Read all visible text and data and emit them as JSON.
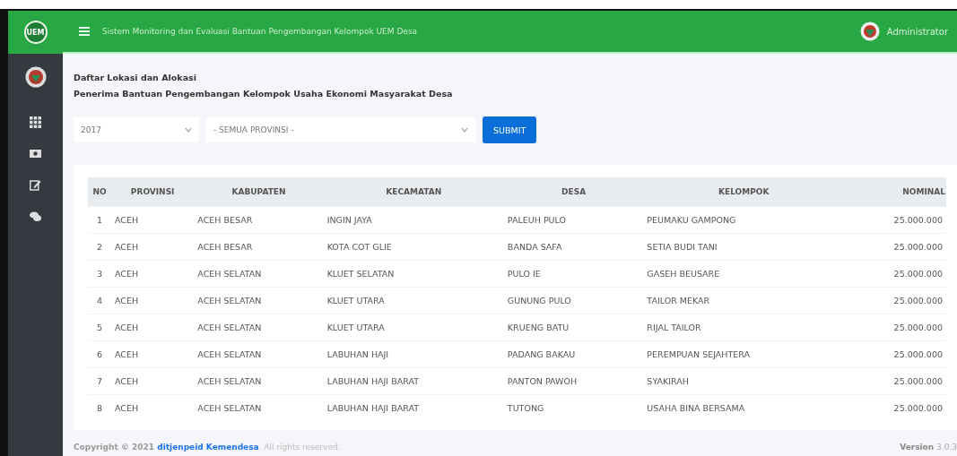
{
  "header": {
    "title": "Sistem Monitoring dan Evaluasi Bantuan Pengembangan Kelompok UEM Desa",
    "user": "Administrator"
  },
  "brand": {
    "logo_text": "UEM"
  },
  "page": {
    "title_lines": [
      "Daftar Lokasi dan Alokasi",
      "Penerima Bantuan Pengembangan Kelompok Usaha Ekonomi Masyarakat Desa"
    ]
  },
  "filters": {
    "year": "2017",
    "province": "- SEMUA PROVINSI -",
    "submit": "SUBMIT"
  },
  "table": {
    "columns": [
      "NO",
      "PROVINSI",
      "KABUPATEN",
      "KECAMATAN",
      "DESA",
      "KELOMPOK",
      "NOMINAL"
    ],
    "rows": [
      [
        "1",
        "ACEH",
        "ACEH BESAR",
        "INGIN JAYA",
        "PALEUH PULO",
        "PEUMAKU GAMPONG",
        "25.000.000"
      ],
      [
        "2",
        "ACEH",
        "ACEH BESAR",
        "KOTA COT GLIE",
        "BANDA SAFA",
        "SETIA BUDI TANI",
        "25.000.000"
      ],
      [
        "3",
        "ACEH",
        "ACEH SELATAN",
        "KLUET SELATAN",
        "PULO IE",
        "GASEH BEUSARE",
        "25.000.000"
      ],
      [
        "4",
        "ACEH",
        "ACEH SELATAN",
        "KLUET UTARA",
        "GUNUNG PULO",
        "TAILOR MEKAR",
        "25.000.000"
      ],
      [
        "5",
        "ACEH",
        "ACEH SELATAN",
        "KLUET UTARA",
        "KRUENG BATU",
        "RIJAL TAILOR",
        "25.000.000"
      ],
      [
        "6",
        "ACEH",
        "ACEH SELATAN",
        "LABUHAN HAJI",
        "PADANG BAKAU",
        "PEREMPUAN SEJAHTERA",
        "25.000.000"
      ],
      [
        "7",
        "ACEH",
        "ACEH SELATAN",
        "LABUHAN HAJI BARAT",
        "PANTON PAWOH",
        "SYAKIRAH",
        "25.000.000"
      ],
      [
        "8",
        "ACEH",
        "ACEH SELATAN",
        "LABUHAN HAJI BARAT",
        "TUTONG",
        "USAHA BINA BERSAMA",
        "25.000.000"
      ]
    ]
  },
  "footer": {
    "copyright": "Copyright © 2021",
    "link": "ditjenpeid Kemendesa",
    "suffix": ". All rights reserved.",
    "version_label": "Version",
    "version": "3.0.3"
  }
}
